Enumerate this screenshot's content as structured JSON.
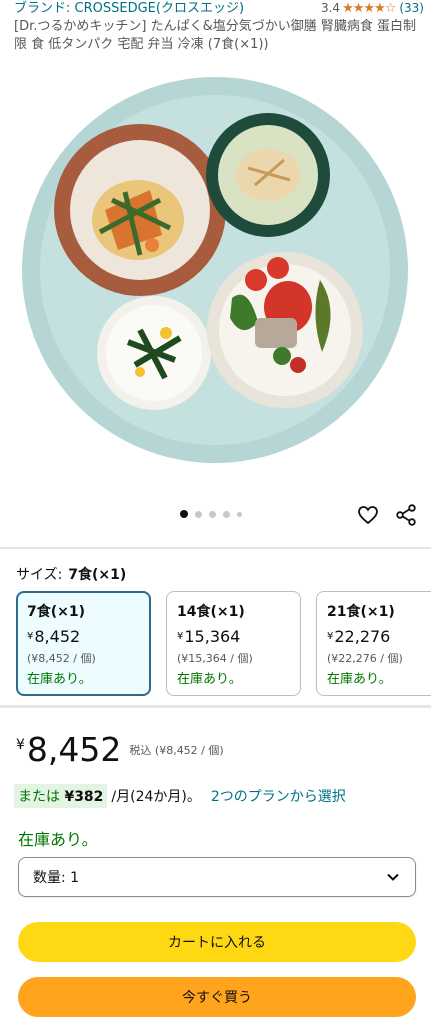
{
  "header": {
    "brand": "ブランド: CROSSEDGE(クロスエッジ)",
    "rating_value": "3.4",
    "rating_stars": "★★★★☆",
    "rating_count": "(33)",
    "title": "[Dr.つるかめキッチン] たんぱく&塩分気づかい御膳 腎臓病食 蛋白制限 食 低タンパク 宅配 弁当 冷凍 (7食(×1))"
  },
  "gallery": {
    "image_count": 5,
    "active_index": 0
  },
  "size": {
    "label": "サイズ:",
    "selected": "7食(×1)",
    "options": [
      {
        "name": "7食(×1)",
        "yen": "¥",
        "price": "8,452",
        "unit": "(¥8,452 / 個)",
        "stock": "在庫あり。"
      },
      {
        "name": "14食(×1)",
        "yen": "¥",
        "price": "15,364",
        "unit": "(¥15,364 / 個)",
        "stock": "在庫あり。"
      },
      {
        "name": "21食(×1)",
        "yen": "¥",
        "price": "22,276",
        "unit": "(¥22,276 / 個)",
        "stock": "在庫あり。"
      }
    ]
  },
  "price": {
    "yen": "¥",
    "amount": "8,452",
    "tax": "税込 (¥8,452 / 個)"
  },
  "installment": {
    "prefix": "または",
    "amount": "¥382",
    "period": "/月(24か月)。",
    "link": "2つのプランから選択"
  },
  "stock": "在庫あり。",
  "quantity": {
    "label": "数量: 1"
  },
  "buttons": {
    "cart": "カートに入れる",
    "buy": "今すぐ買う"
  },
  "colors": {
    "link": "#007185",
    "in_stock": "#007600",
    "star": "#de7921",
    "cart_button": "#ffd814",
    "buy_button": "#ffa41c",
    "selected_border": "#2d6b8c"
  }
}
